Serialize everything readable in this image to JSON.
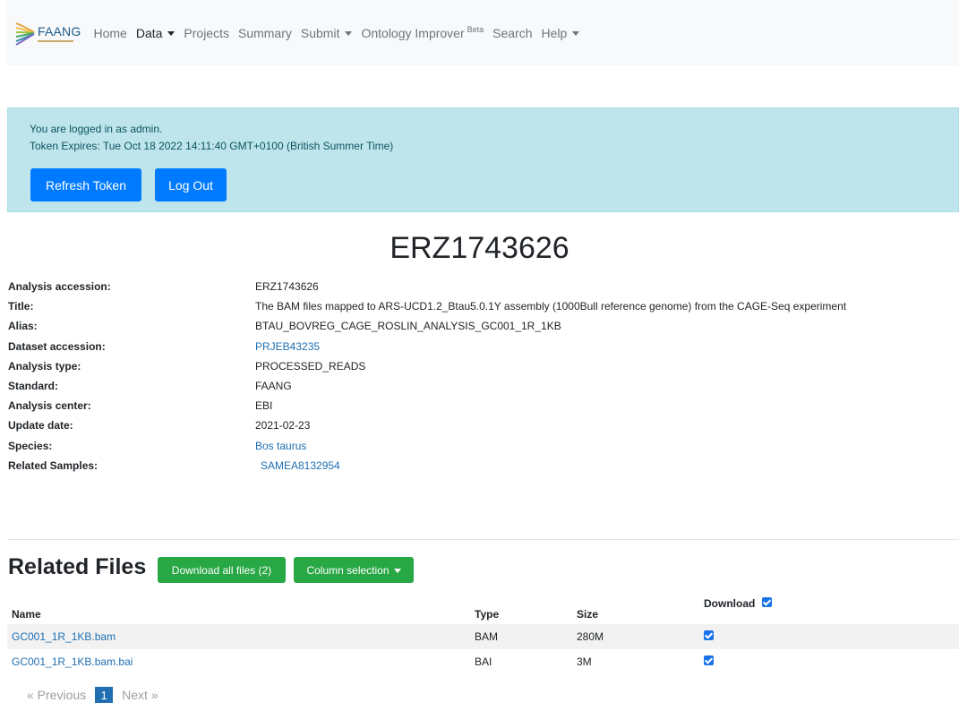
{
  "navbar": {
    "brand": "FAANG",
    "items": [
      {
        "label": "Home",
        "dropdown": false,
        "active": false
      },
      {
        "label": "Data",
        "dropdown": true,
        "active": true
      },
      {
        "label": "Projects",
        "dropdown": false,
        "active": false
      },
      {
        "label": "Summary",
        "dropdown": false,
        "active": false
      },
      {
        "label": "Submit",
        "dropdown": true,
        "active": false
      },
      {
        "label": "Ontology Improver",
        "sup": "Beta",
        "dropdown": false,
        "active": false
      },
      {
        "label": "Search",
        "dropdown": false,
        "active": false
      },
      {
        "label": "Help",
        "dropdown": true,
        "active": false
      }
    ]
  },
  "alert": {
    "logged_in": "You are logged in as admin.",
    "token_expires": "Token Expires: Tue Oct 18 2022 14:11:40 GMT+0100 (British Summer Time)",
    "refresh_label": "Refresh Token",
    "logout_label": "Log Out"
  },
  "page_title": "ERZ1743626",
  "details": [
    {
      "label": "Analysis accession:",
      "value": "ERZ1743626",
      "link": false
    },
    {
      "label": "Title:",
      "value": "The BAM files mapped to ARS-UCD1.2_Btau5.0.1Y assembly (1000Bull reference genome) from the CAGE-Seq experiment",
      "link": false
    },
    {
      "label": "Alias:",
      "value": "BTAU_BOVREG_CAGE_ROSLIN_ANALYSIS_GC001_1R_1KB",
      "link": false
    },
    {
      "label": "Dataset accession:",
      "value": "PRJEB43235",
      "link": true
    },
    {
      "label": "Analysis type:",
      "value": "PROCESSED_READS",
      "link": false
    },
    {
      "label": "Standard:",
      "value": "FAANG",
      "link": false
    },
    {
      "label": "Analysis center:",
      "value": "EBI",
      "link": false
    },
    {
      "label": "Update date:",
      "value": "2021-02-23",
      "link": false
    },
    {
      "label": "Species:",
      "value": "Bos taurus",
      "link": true
    },
    {
      "label": "Related Samples:",
      "value": "SAMEA8132954",
      "link": true
    }
  ],
  "related_files": {
    "title": "Related Files",
    "download_all_label": "Download all files (2)",
    "column_selection_label": "Column selection",
    "columns": {
      "name": "Name",
      "type": "Type",
      "size": "Size",
      "download": "Download"
    },
    "rows": [
      {
        "name": "GC001_1R_1KB.bam",
        "type": "BAM",
        "size": "280M",
        "checked": true
      },
      {
        "name": "GC001_1R_1KB.bam.bai",
        "type": "BAI",
        "size": "3M",
        "checked": true
      }
    ]
  },
  "pagination": {
    "previous": "« Previous",
    "current": "1",
    "next": "Next »"
  },
  "colors": {
    "primary": "#007bff",
    "success": "#28a745",
    "alert_bg": "#bee5eb",
    "link": "#1f6fb2"
  }
}
